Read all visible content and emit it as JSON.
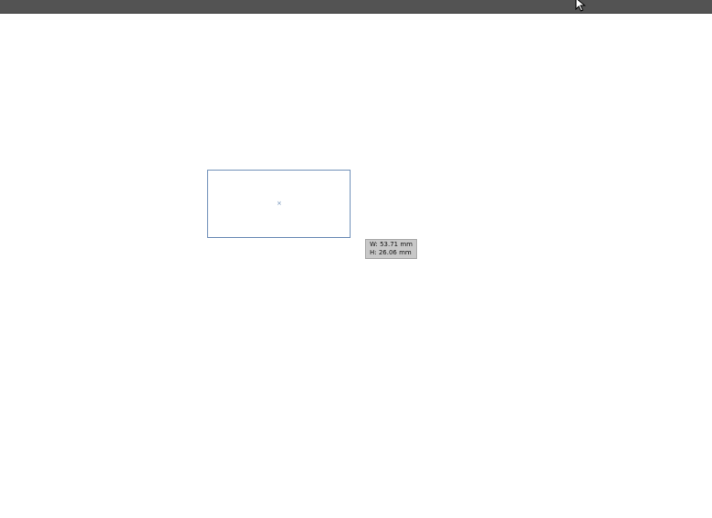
{
  "tooltip": {
    "width": "W: 53.71 mm",
    "height": "H: 26.06 mm"
  },
  "center_marker": "×",
  "colors": {
    "top_bar": "#535353",
    "selection_stroke": "#6f8fb8",
    "tooltip_bg": "#c8c8c8",
    "canvas": "#ffffff"
  },
  "icons": {
    "cursor": "mouse-pointer-icon"
  }
}
